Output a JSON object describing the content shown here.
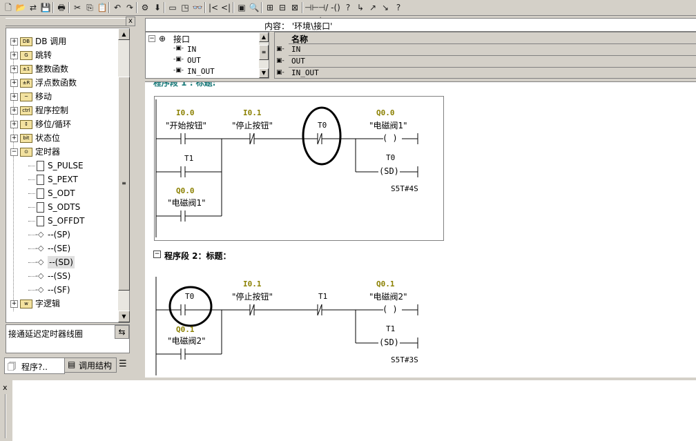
{
  "toolbar": {
    "icons": [
      "new-icon",
      "open-icon",
      "network-icon",
      "save-icon",
      "print-icon",
      "cut-icon",
      "copy-icon",
      "paste-icon",
      "undo-icon",
      "redo-icon",
      "compile-icon",
      "download-icon",
      "window-icon",
      "monitor-icon",
      "glasses-icon",
      "prev-icon",
      "next-icon",
      "overview-icon",
      "zoom-icon",
      "insert-network-icon",
      "branch-icon",
      "parallel-icon",
      "no-contact-icon",
      "nc-contact-icon",
      "coil-icon",
      "box-icon",
      "open-branch-icon",
      "close-branch-icon",
      "connect-icon",
      "help-icon"
    ],
    "glyphs": [
      "🗋",
      "📂",
      "⇄",
      "💾",
      "🖶",
      "✂",
      "⎘",
      "📋",
      "↶",
      "↷",
      "⚙",
      "⬇",
      "▭",
      "◳",
      "👓",
      "|<",
      "<|",
      "▣",
      "🔍",
      "⊞",
      "⊟",
      "⊠",
      "⊣⊢",
      "⊣/⊢",
      "-()",
      "?",
      "↳",
      "↗",
      "↘",
      "?"
    ]
  },
  "tree": {
    "items": [
      {
        "label": "DB 调用",
        "exp": "+",
        "icon": "DB"
      },
      {
        "label": "跳转",
        "exp": "+",
        "icon": "G"
      },
      {
        "label": "整数函数",
        "exp": "+",
        "icon": "±1"
      },
      {
        "label": "浮点数函数",
        "exp": "+",
        "icon": "±R"
      },
      {
        "label": "移动",
        "exp": "+",
        "icon": "~"
      },
      {
        "label": "程序控制",
        "exp": "+",
        "icon": "ctrl"
      },
      {
        "label": "移位/循环",
        "exp": "+",
        "icon": "↕"
      },
      {
        "label": "状态位",
        "exp": "+",
        "icon": "bit"
      },
      {
        "label": "定时器",
        "exp": "-",
        "icon": "⊙"
      },
      {
        "label": "S_PULSE",
        "child": "box"
      },
      {
        "label": "S_PEXT",
        "child": "box"
      },
      {
        "label": "S_ODT",
        "child": "box"
      },
      {
        "label": "S_ODTS",
        "child": "box"
      },
      {
        "label": "S_OFFDT",
        "child": "box"
      },
      {
        "label": "--(SP)",
        "child": "coil"
      },
      {
        "label": "--(SE)",
        "child": "coil"
      },
      {
        "label": "--(SD)",
        "child": "coil",
        "selected": true
      },
      {
        "label": "--(SS)",
        "child": "coil"
      },
      {
        "label": "--(SF)",
        "child": "coil"
      },
      {
        "label": "字逻辑",
        "exp": "+",
        "icon": "w"
      }
    ]
  },
  "description": "接通延迟定时器线圈",
  "desc_arrow": "⇆",
  "left_tabs": {
    "program": "程序?..",
    "callstruct": "调用结构"
  },
  "content_path": "内容：  '环境\\接口'",
  "interface_tree": {
    "root": "接口",
    "items": [
      "IN",
      "OUT",
      "IN_OUT"
    ]
  },
  "names_table": {
    "header": "名称",
    "rows": [
      "IN",
      "OUT",
      "IN_OUT"
    ]
  },
  "network1": {
    "header_partial": "程序段 1 : 标题:",
    "c1_addr": "I0.0",
    "c1_sym": "\"开始按钮\"",
    "c2_addr": "I0.1",
    "c2_sym": "\"停止按钮\"",
    "c3_addr": "T0",
    "coil_addr": "Q0.0",
    "coil_sym": "\"电磁阀1\"",
    "coil_glyph": "( )",
    "b1_addr": "T1",
    "b2_addr": "Q0.0",
    "b2_sym": "\"电磁阀1\"",
    "timer_addr": "T0",
    "timer_glyph": "(SD)",
    "timer_val": "S5T#4S"
  },
  "network2": {
    "title": "程序段 2：标题：",
    "c1_addr": "T0",
    "c2_addr": "I0.1",
    "c2_sym": "\"停止按钮\"",
    "c3_addr": "T1",
    "coil_addr": "Q0.1",
    "coil_sym": "\"电磁阀2\"",
    "coil_glyph": "( )",
    "b1_addr": "Q0.1",
    "b1_sym": "\"电磁阀2\"",
    "timer_addr": "T1",
    "timer_glyph": "(SD)",
    "timer_val": "S5T#3S"
  },
  "bottom_close": "x"
}
